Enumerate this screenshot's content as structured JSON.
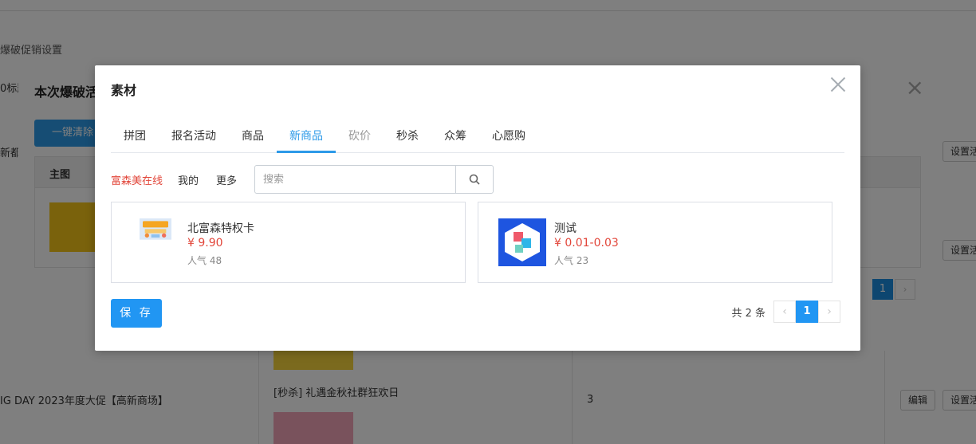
{
  "background": {
    "breadcrumb": "爆破促销设置",
    "partial_mark": "0标题",
    "partial_left": "新都",
    "row_title": "IG DAY 2023年度大促【高新商场】",
    "row_name": "[秒杀] 礼遇金秋社群狂欢日",
    "row_count": "3",
    "settings_label": "设置活",
    "edit_label": "编辑"
  },
  "back_dialog": {
    "title": "本次爆破活",
    "clear_button": "一键清除",
    "column_main_image": "主图",
    "page_current": "1",
    "close_icon": "×"
  },
  "dialog": {
    "title": "素材",
    "tabs": [
      {
        "label": "拼团"
      },
      {
        "label": "报名活动"
      },
      {
        "label": "商品"
      },
      {
        "label": "新商品"
      },
      {
        "label": "砍价"
      },
      {
        "label": "秒杀"
      },
      {
        "label": "众筹"
      },
      {
        "label": "心愿购"
      }
    ],
    "active_tab": "新商品",
    "sources": {
      "primary": "富森美在线",
      "mine": "我的",
      "more": "更多"
    },
    "search": {
      "placeholder": "搜索",
      "value": ""
    },
    "products": [
      {
        "name": "北富森特权卡",
        "price": "¥ 9.90",
        "popularity": "人气 48"
      },
      {
        "name": "测试",
        "price": "¥ 0.01-0.03",
        "popularity": "人气 23"
      }
    ],
    "save_label": "保 存",
    "pagination": {
      "total": "共 2 条",
      "current": "1",
      "prev": "‹",
      "next": "›"
    }
  },
  "colors": {
    "accent": "#2196f3",
    "price_red": "#e2463a",
    "overlay": "rgba(0,0,0,0.5)"
  }
}
